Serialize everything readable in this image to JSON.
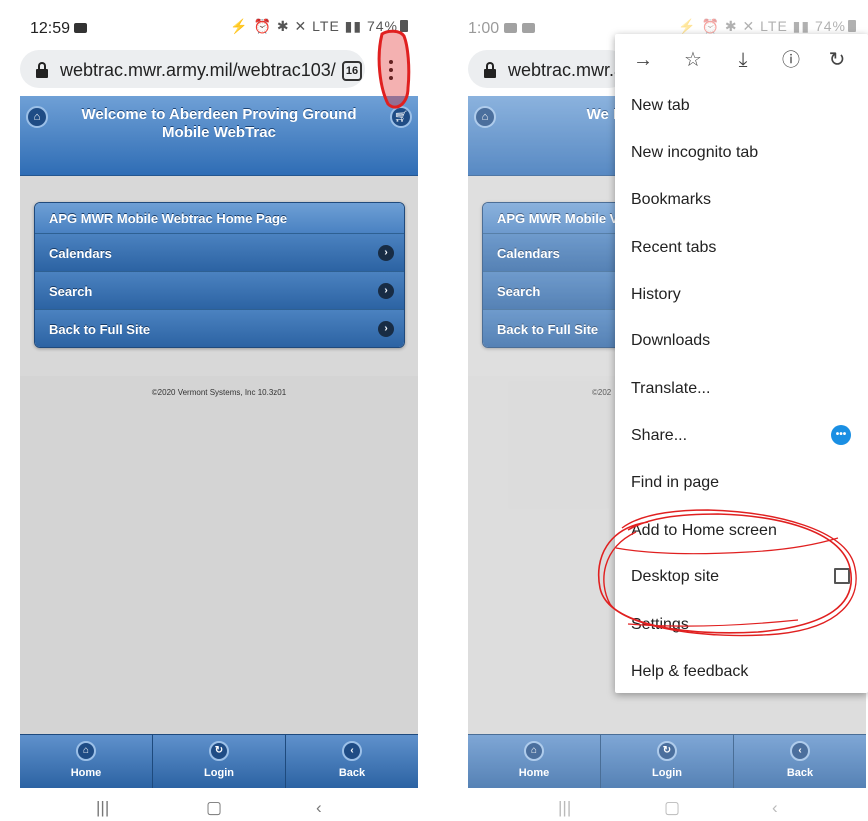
{
  "left_screen": {
    "status": {
      "time": "12:59",
      "right": "⚡ ⏰ ✱ ✕ LTE ▮▮ 74%"
    },
    "browser": {
      "url": "webtrac.mwr.army.mil/webtrac103/",
      "tab_count": "16"
    },
    "header": {
      "title": "Welcome to Aberdeen Proving Ground Mobile WebTrac"
    },
    "list": [
      {
        "label": "APG MWR Mobile Webtrac Home Page"
      },
      {
        "label": "Calendars"
      },
      {
        "label": "Search"
      },
      {
        "label": "Back to Full Site"
      }
    ],
    "footer": {
      "copyright": "©2020 Vermont Systems, Inc 10.3z01"
    },
    "navbar": [
      {
        "label": "Home",
        "icon": "home-icon"
      },
      {
        "label": "Login",
        "icon": "refresh-icon"
      },
      {
        "label": "Back",
        "icon": "back-icon"
      }
    ]
  },
  "right_screen": {
    "status": {
      "time": "1:00",
      "right": "⚡ ⏰ ✱ ✕ LTE ▮▮ 74%"
    },
    "browser": {
      "url": "webtrac.mwr.a"
    },
    "header": {
      "title_fragment": "We Pro"
    },
    "list": [
      {
        "label": "APG MWR Mobile V"
      },
      {
        "label": "Calendars"
      },
      {
        "label": "Search"
      },
      {
        "label": "Back to Full Site"
      }
    ],
    "footer": {
      "copyright_fragment": "©202"
    },
    "menu": {
      "toolbar": [
        "forward-icon",
        "star-icon",
        "download-icon",
        "info-icon",
        "reload-icon"
      ],
      "items": [
        {
          "label": "New tab"
        },
        {
          "label": "New incognito tab"
        },
        {
          "label": "Bookmarks"
        },
        {
          "label": "Recent tabs"
        },
        {
          "label": "History"
        },
        {
          "label": "Downloads"
        },
        {
          "label": "Translate..."
        },
        {
          "label": "Share..."
        },
        {
          "label": "Find in page"
        },
        {
          "label": "Add to Home screen"
        },
        {
          "label": "Desktop site"
        },
        {
          "label": "Settings"
        },
        {
          "label": "Help & feedback"
        }
      ],
      "desktop_site_checked": false
    },
    "navbar": [
      {
        "label": "Home",
        "icon": "home-icon"
      },
      {
        "label": "Login",
        "icon": "refresh-icon"
      },
      {
        "label": "Back",
        "icon": "back-icon"
      }
    ]
  },
  "colors": {
    "header_blue": "#2f6db5",
    "annotation_red": "#e02020",
    "share_blue": "#1a8fe3"
  }
}
